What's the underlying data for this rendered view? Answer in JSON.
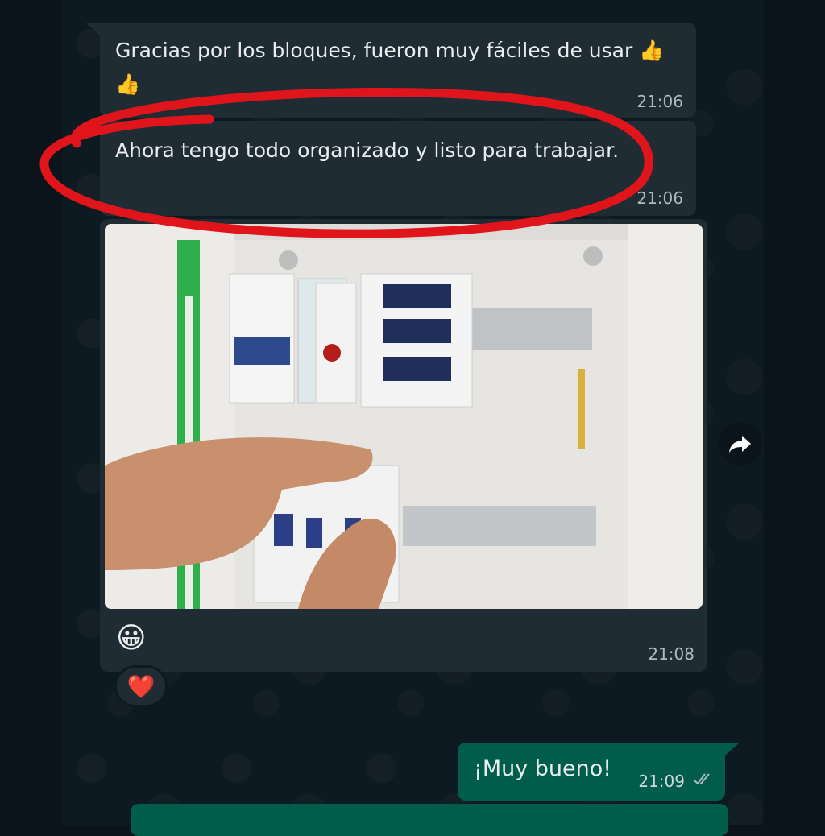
{
  "messages": [
    {
      "text": "Gracias por los bloques, fueron muy fáciles de usar 👍👍",
      "time": "21:06"
    },
    {
      "text": "Ahora tengo todo organizado y listo para trabajar.",
      "time": "21:06"
    },
    {
      "type": "image",
      "caption": "😀",
      "time": "21:08",
      "reaction": "❤️"
    },
    {
      "text": "¡Muy bueno!",
      "time": "21:09",
      "status": "double-check-icon"
    }
  ],
  "colors": {
    "incoming": "#202c33",
    "outgoing": "#005c4b",
    "annotation": "#e0151c"
  }
}
